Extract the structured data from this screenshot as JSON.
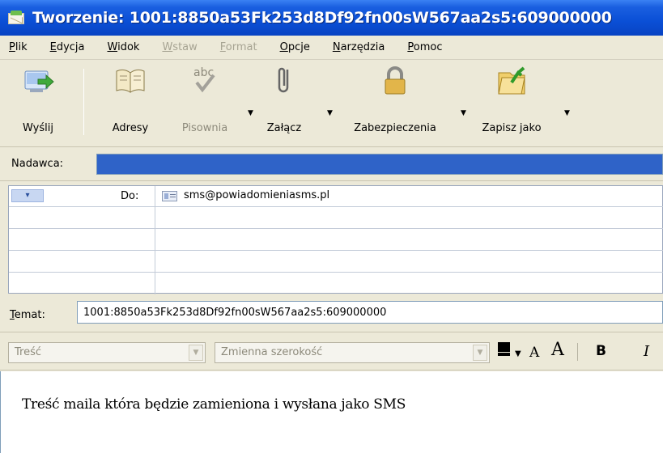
{
  "window": {
    "title": "Tworzenie: 1001:8850a53Fk253d8Df92fn00sW567aa2s5:609000000"
  },
  "menu": [
    {
      "label": "Plik",
      "enabled": true
    },
    {
      "label": "Edycja",
      "enabled": true
    },
    {
      "label": "Widok",
      "enabled": true
    },
    {
      "label": "Wstaw",
      "enabled": false
    },
    {
      "label": "Format",
      "enabled": false
    },
    {
      "label": "Opcje",
      "enabled": true
    },
    {
      "label": "Narzędzia",
      "enabled": true
    },
    {
      "label": "Pomoc",
      "enabled": true
    }
  ],
  "toolbar": {
    "send": "Wyślij",
    "addresses": "Adresy",
    "spelling": "Pisownia",
    "spelling_icon_text": "abc",
    "attach": "Załącz",
    "security": "Zabezpieczenia",
    "save_as": "Zapisz jako"
  },
  "header": {
    "from_label": "Nadawca:",
    "to_label": "Do:",
    "to_address": "sms@powiadomieniasms.pl",
    "subject_label": "Temat:",
    "subject_value": "1001:8850a53Fk253d8Df92fn00sW567aa2s5:609000000"
  },
  "format_bar": {
    "style_combo": "Treść",
    "font_combo": "Zmienna szerokość",
    "shrink": "A",
    "grow": "A",
    "bold": "B",
    "italic": "I"
  },
  "message": {
    "body": "Treść maila która będzie zamieniona i wysłana jako SMS"
  },
  "colors": {
    "titlebar": "#0a4fd6",
    "chrome": "#ece9d8",
    "selection": "#2f63c8"
  }
}
